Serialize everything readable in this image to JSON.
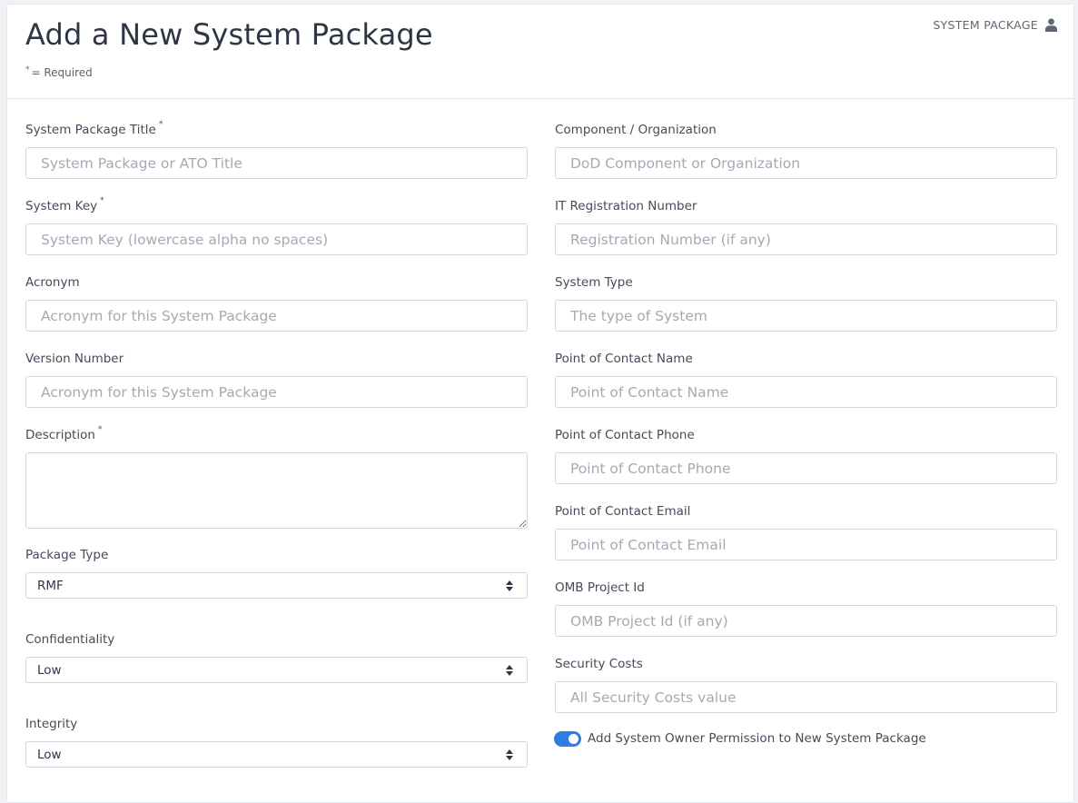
{
  "header": {
    "title": "Add a New System Package",
    "required_note": "= Required",
    "required_symbol": "*",
    "nav_link": "SYSTEM PACKAGE",
    "nav_icon": "user-icon"
  },
  "left_fields": {
    "title": {
      "label": "System Package Title",
      "placeholder": "System Package or ATO Title",
      "required": true
    },
    "system_key": {
      "label": "System Key",
      "placeholder": "System Key (lowercase alpha no spaces)",
      "required": true
    },
    "acronym": {
      "label": "Acronym",
      "placeholder": "Acronym for this System Package"
    },
    "version_number": {
      "label": "Version Number",
      "placeholder": "Acronym for this System Package"
    },
    "description": {
      "label": "Description",
      "value": "",
      "required": true
    },
    "package_type": {
      "label": "Package Type",
      "value": "RMF"
    },
    "confidentiality": {
      "label": "Confidentiality",
      "value": "Low"
    },
    "integrity": {
      "label": "Integrity",
      "value": "Low"
    }
  },
  "right_fields": {
    "component": {
      "label": "Component / Organization",
      "placeholder": "DoD Component or Organization"
    },
    "it_registration": {
      "label": "IT Registration Number",
      "placeholder": "Registration Number (if any)"
    },
    "system_type": {
      "label": "System Type",
      "placeholder": "The type of System"
    },
    "poc_name": {
      "label": "Point of Contact Name",
      "placeholder": "Point of Contact Name"
    },
    "poc_phone": {
      "label": "Point of Contact Phone",
      "placeholder": "Point of Contact Phone"
    },
    "poc_email": {
      "label": "Point of Contact Email",
      "placeholder": "Point of Contact Email"
    },
    "omb_project_id": {
      "label": "OMB Project Id",
      "placeholder": "OMB Project Id (if any)"
    },
    "security_costs": {
      "label": "Security Costs",
      "placeholder": "All Security Costs value"
    }
  },
  "toggle": {
    "label": "Add System Owner Permission to New System Package",
    "checked": true
  },
  "colors": {
    "accent": "#2f7de3",
    "placeholder": "#a4aab4",
    "border": "#d4d8de"
  }
}
